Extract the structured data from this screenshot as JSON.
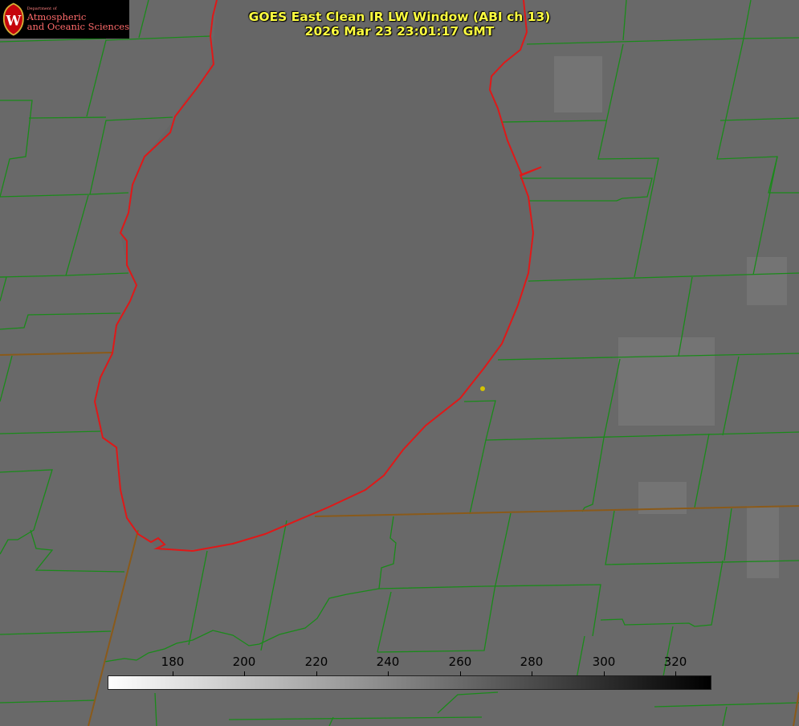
{
  "logo": {
    "department_line": "Department of",
    "line1": "Atmospheric",
    "line2": "and Oceanic Sciences"
  },
  "title": {
    "line1": "GOES East Clean IR LW Window (ABI ch 13)",
    "line2": "2026 Mar 23 23:01:17 GMT"
  },
  "colorbar": {
    "min": 162,
    "max": 330,
    "tick_values": [
      180,
      200,
      220,
      240,
      260,
      280,
      300,
      320
    ],
    "tick_labels": [
      "180",
      "200",
      "220",
      "240",
      "260",
      "280",
      "300",
      "320"
    ],
    "color_low": "#ffffff",
    "color_high": "#000000"
  },
  "colors": {
    "background_gray": "#696969",
    "county_lines": "#1a8a1a",
    "shoreline": "#ff2020",
    "title_text": "#ffff40",
    "logo_text": "#ff6b6b",
    "station_marker": "#d4c400"
  }
}
